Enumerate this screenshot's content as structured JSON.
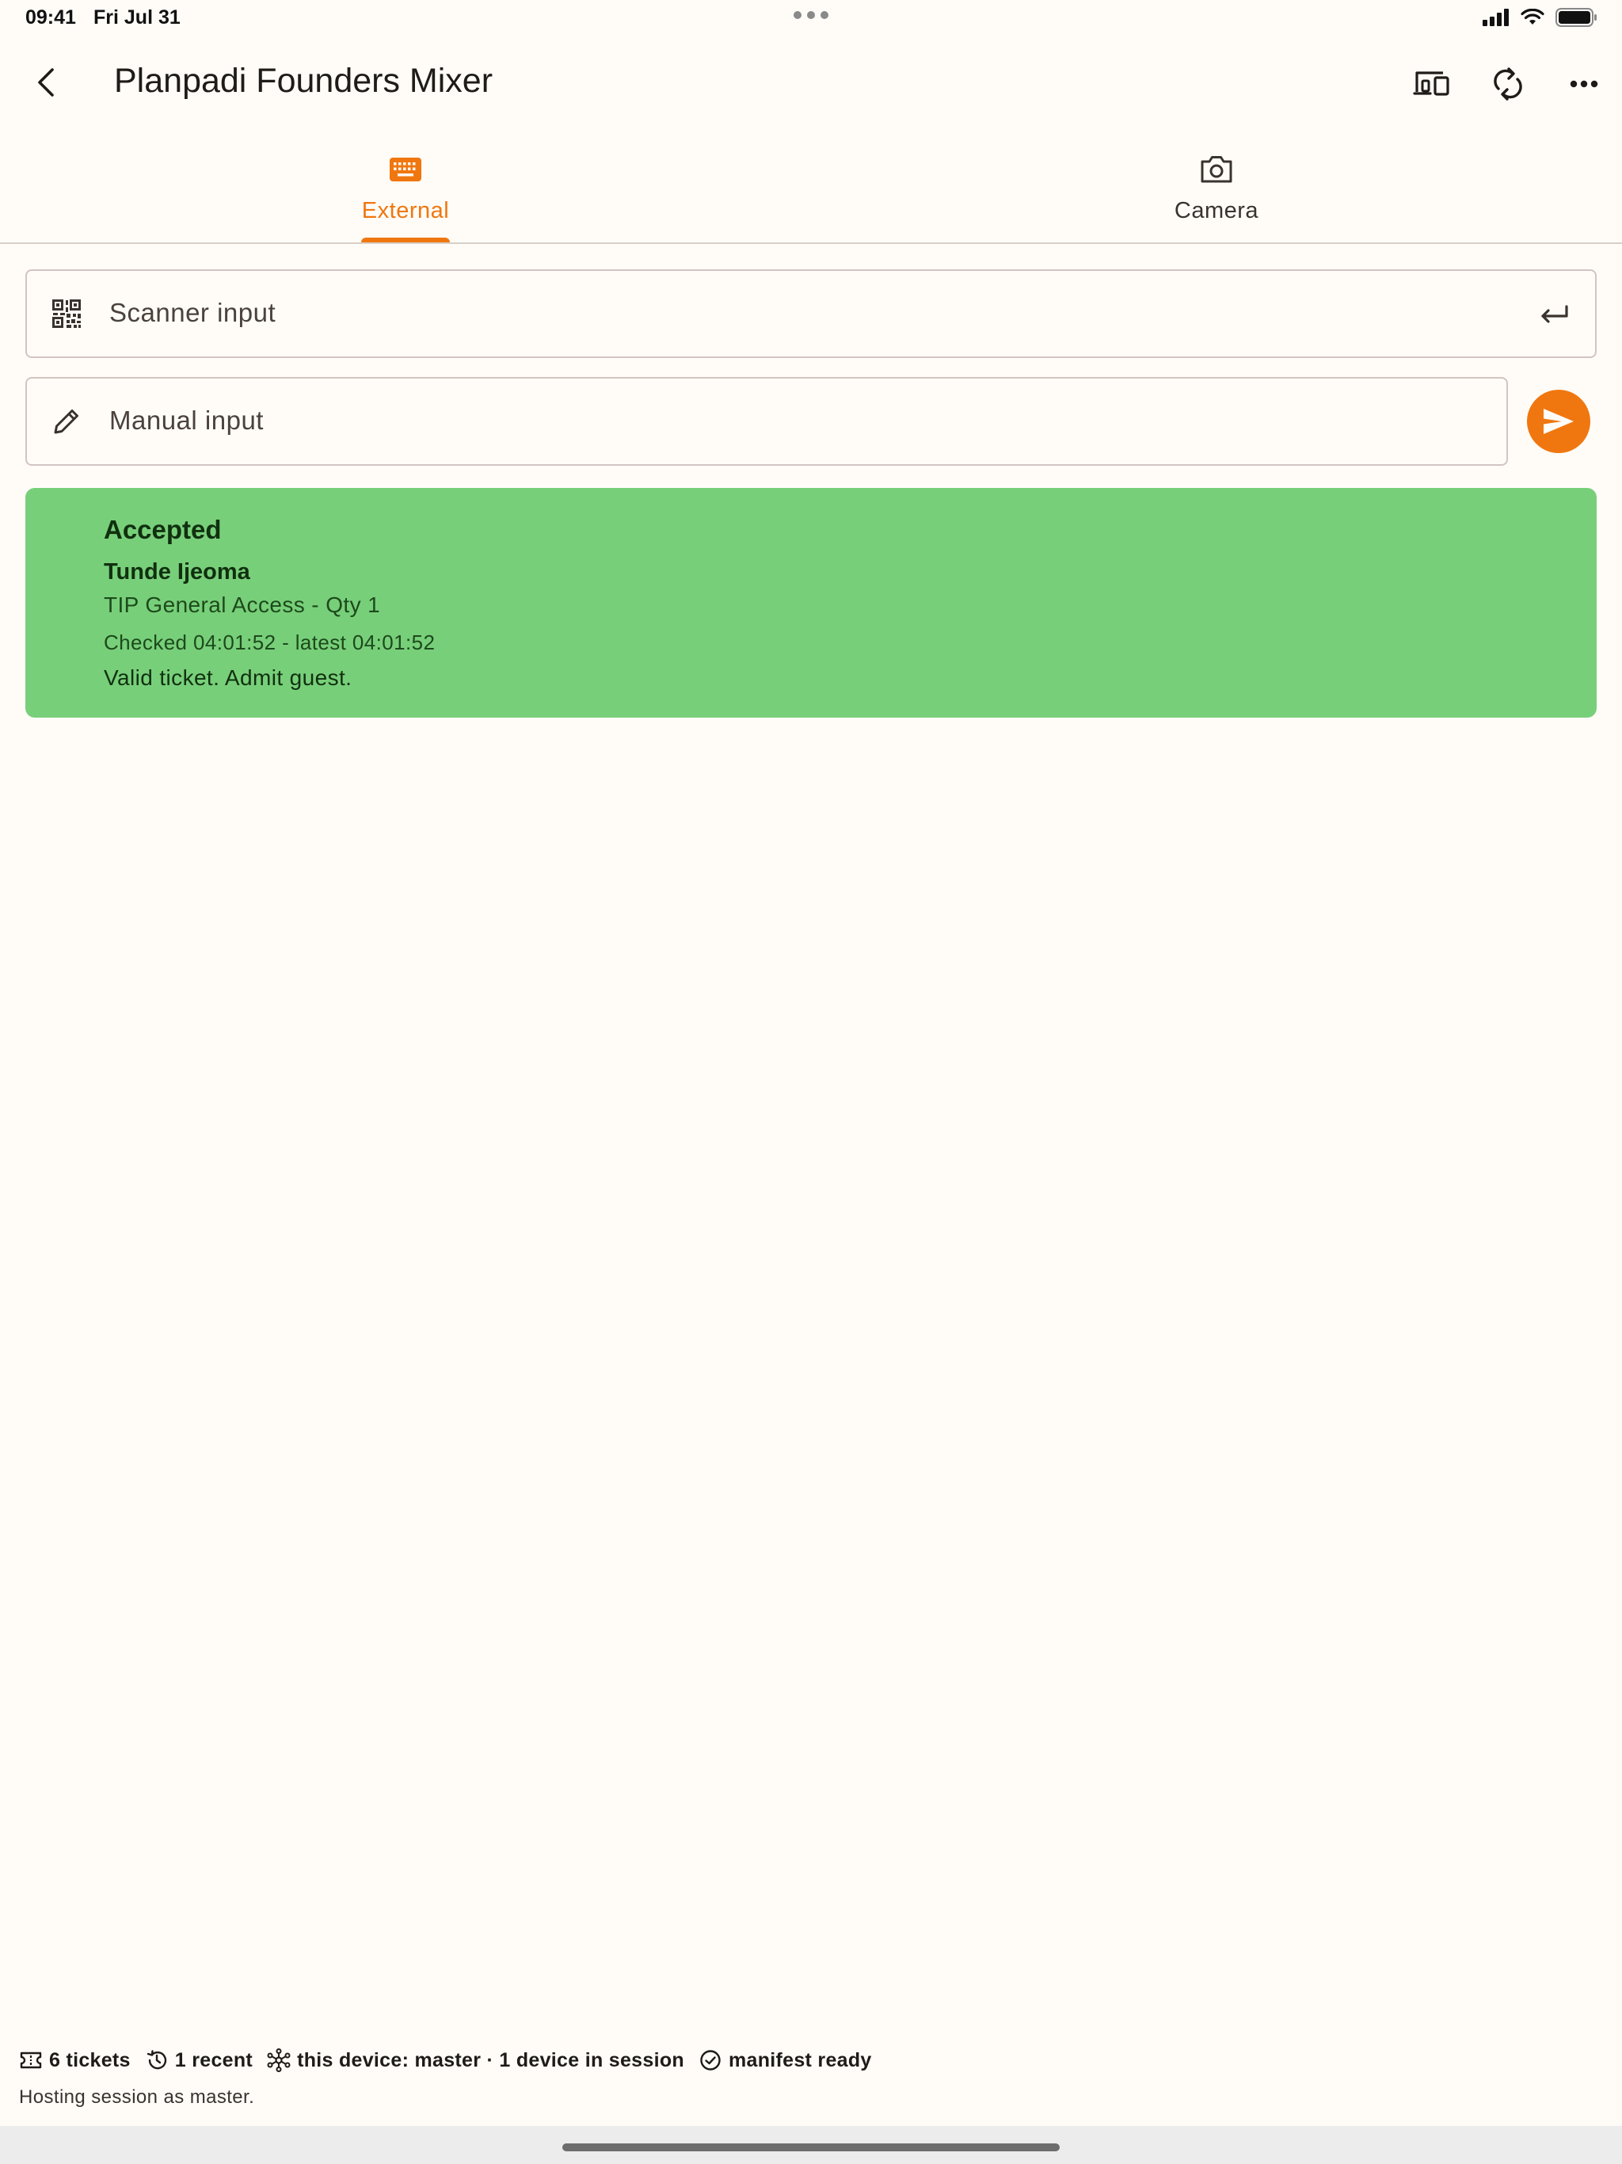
{
  "status_bar": {
    "time": "09:41",
    "date": "Fri Jul 31",
    "icons": [
      "cellular-signal-icon",
      "wifi-icon",
      "battery-icon"
    ]
  },
  "app_bar": {
    "title": "Planpadi Founders Mixer",
    "icons": [
      "back-arrow-icon",
      "devices-icon",
      "sync-icon",
      "more-horizontal-icon"
    ]
  },
  "tabs": [
    {
      "label": "External",
      "icon": "keyboard-icon",
      "active": true
    },
    {
      "label": "Camera",
      "icon": "camera-icon",
      "active": false
    }
  ],
  "scanner_field": {
    "placeholder": "Scanner input",
    "icon": "qr-code-icon",
    "action_icon": "enter-icon"
  },
  "manual_field": {
    "placeholder": "Manual input",
    "icon": "pencil-icon",
    "send_icon": "send-icon"
  },
  "result": {
    "status": "Accepted",
    "name": "Tunde Ijeoma",
    "ticket": "TIP General Access - Qty 1",
    "checked": "Checked 04:01:52 - latest 04:01:52",
    "message": "Valid ticket. Admit guest."
  },
  "footer": {
    "chips": [
      {
        "icon": "ticket-icon",
        "label": "6 tickets"
      },
      {
        "icon": "history-icon",
        "label": "1 recent"
      },
      {
        "icon": "network-icon",
        "label": "this device: master · 1 device in session"
      },
      {
        "icon": "check-circle-icon",
        "label": "manifest ready"
      }
    ],
    "subtitle": "Hosting session as master."
  },
  "colors": {
    "accent": "#f0770f",
    "background": "#fffcf8",
    "success": "#78cf7a",
    "success_text": "#10300f"
  }
}
